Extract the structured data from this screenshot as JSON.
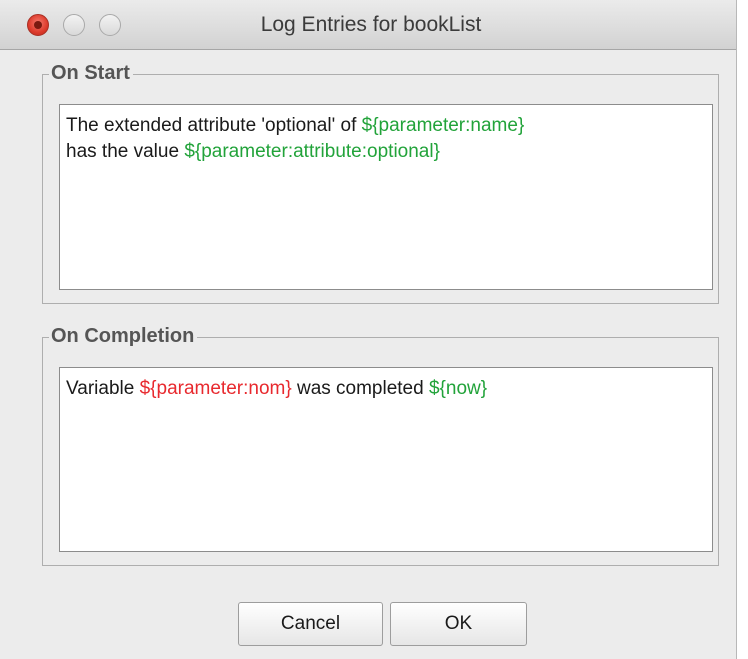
{
  "window": {
    "title": "Log Entries for bookList"
  },
  "on_start": {
    "heading": "On Start",
    "line1_text": "The extended attribute 'optional' of ",
    "line1_var": "${parameter:name}",
    "line2_text": "has the value ",
    "line2_var": "${parameter:attribute:optional}"
  },
  "on_completion": {
    "heading": "On Completion",
    "text_a": "Variable ",
    "var_invalid": "${parameter:nom}",
    "text_b": " was completed ",
    "var_now": "${now}"
  },
  "buttons": {
    "cancel": "Cancel",
    "ok": "OK"
  },
  "colors": {
    "valid_variable": "#22a33a",
    "invalid_variable": "#e8292e",
    "close_button": "#dd3b2c"
  },
  "icons": {
    "close": "close-icon",
    "minimize": "minimize-icon",
    "zoom": "zoom-icon"
  }
}
